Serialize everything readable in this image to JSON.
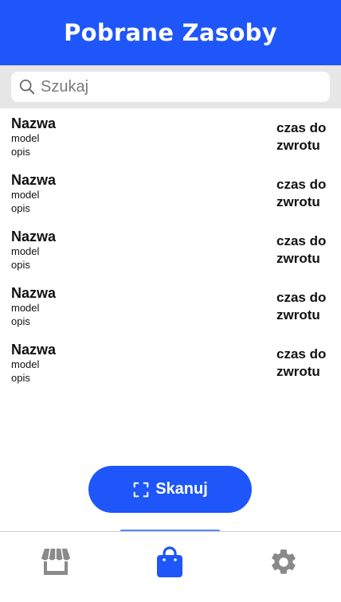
{
  "header": {
    "title": "Pobrane Zasoby"
  },
  "search": {
    "placeholder": "Szukaj",
    "value": ""
  },
  "items": [
    {
      "name": "Nazwa",
      "model": "model",
      "description": "opis",
      "return_line1": "czas do",
      "return_line2": "zwrotu"
    },
    {
      "name": "Nazwa",
      "model": "model",
      "description": "opis",
      "return_line1": "czas do",
      "return_line2": "zwrotu"
    },
    {
      "name": "Nazwa",
      "model": "model",
      "description": "opis",
      "return_line1": "czas do",
      "return_line2": "zwrotu"
    },
    {
      "name": "Nazwa",
      "model": "model",
      "description": "opis",
      "return_line1": "czas do",
      "return_line2": "zwrotu"
    },
    {
      "name": "Nazwa",
      "model": "model",
      "description": "opis",
      "return_line1": "czas do",
      "return_line2": "zwrotu"
    }
  ],
  "scan_button": {
    "label": "Skanuj",
    "icon": "scan-frame-icon"
  },
  "bottom_nav": {
    "items": [
      {
        "icon": "store-icon",
        "active": false
      },
      {
        "icon": "shopping-bag-icon",
        "active": true
      },
      {
        "icon": "gear-icon",
        "active": false
      }
    ]
  },
  "colors": {
    "primary": "#1e56fa",
    "search_bg": "#e6e6e6",
    "nav_inactive": "#8a8a8a",
    "nav_active": "#1e56fa"
  }
}
